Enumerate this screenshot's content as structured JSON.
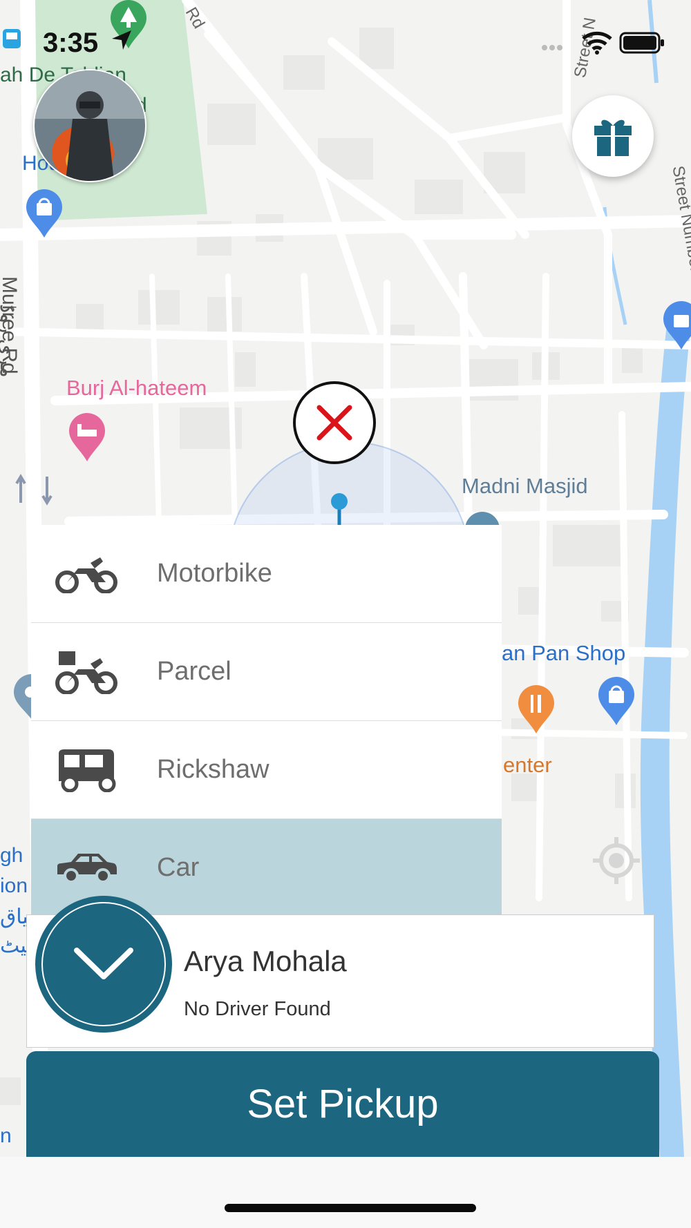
{
  "status_bar": {
    "time": "3:35"
  },
  "map": {
    "labels": {
      "tablighi": "ah De Tablian",
      "tablighi_line2": "d",
      "expert": "Hou Expert",
      "murree_ur": "مری روڈ",
      "murree": "Murree Rd",
      "burj": "Burj Al-hateem",
      "madni": "Madni Masjid",
      "pan_shop": "an Pan Shop",
      "center": "enter",
      "street_n1": "Street N",
      "street_number": "Street Number",
      "rd_top": "Rd",
      "left_gh": "gh",
      "left_ion": "ion",
      "left_ur1": "لیاق",
      "left_ur2": "میٹ",
      "left_n": "n"
    }
  },
  "vehicles": [
    {
      "label": "Motorbike",
      "icon": "motorbike-icon",
      "selected": false
    },
    {
      "label": "Parcel",
      "icon": "parcel-bike-icon",
      "selected": false
    },
    {
      "label": "Rickshaw",
      "icon": "rickshaw-icon",
      "selected": false
    },
    {
      "label": "Car",
      "icon": "car-icon",
      "selected": true
    }
  ],
  "location_card": {
    "name": "Arya Mohala",
    "status": "No Driver Found"
  },
  "pickup_button": {
    "label": "Set Pickup"
  },
  "colors": {
    "primary": "#1c6680",
    "selected_row": "#bad5dc",
    "close_x": "#d9141b",
    "poi_pink": "#e6679b",
    "poi_blue": "#4d8de8",
    "poi_orange": "#f08d3e",
    "water": "#a8d2f5"
  }
}
